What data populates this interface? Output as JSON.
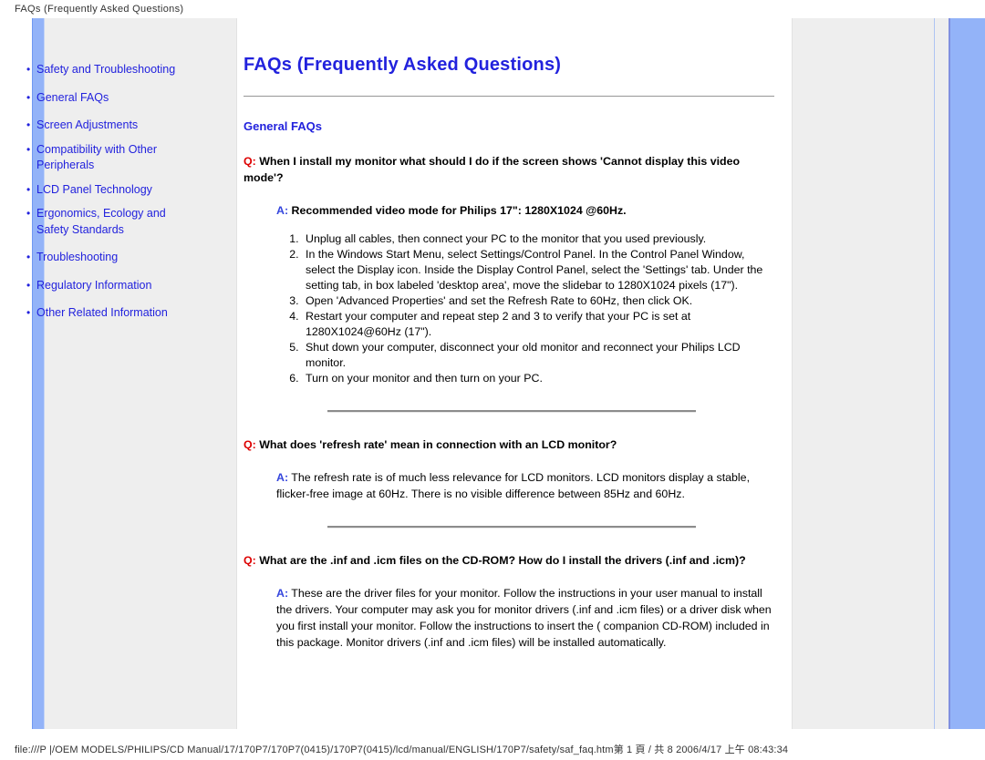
{
  "print": {
    "header": "FAQs (Frequently Asked Questions)",
    "footer": "file:///P |/OEM MODELS/PHILIPS/CD Manual/17/170P7/170P7(0415)/170P7(0415)/lcd/manual/ENGLISH/170P7/safety/saf_faq.htm第 1 頁 / 共 8 2006/4/17 上午 08:43:34"
  },
  "sidebar": {
    "items": [
      {
        "label": "Safety and Troubleshooting"
      },
      {
        "label": "General FAQs"
      },
      {
        "label": "Screen Adjustments"
      },
      {
        "label": "Compatibility with Other Peripherals"
      },
      {
        "label": "LCD Panel Technology"
      },
      {
        "label": "Ergonomics, Ecology and Safety Standards"
      },
      {
        "label": "Troubleshooting"
      },
      {
        "label": "Regulatory Information"
      },
      {
        "label": "Other Related Information"
      }
    ]
  },
  "content": {
    "title": "FAQs (Frequently Asked Questions)",
    "section_title": "General FAQs",
    "q_prefix": "Q:",
    "a_prefix": "A:",
    "faqs": [
      {
        "question": "When I install my monitor what should I do if the screen shows 'Cannot display this video mode'?",
        "answer": "Recommended video mode for Philips 17\": 1280X1024 @60Hz.",
        "answer_bold": true,
        "steps": [
          "Unplug all cables, then connect your PC to the monitor that you used previously.",
          "In the Windows Start Menu, select Settings/Control Panel. In the Control Panel Window, select the Display icon. Inside the Display Control Panel, select the 'Settings' tab. Under the setting tab, in box labeled 'desktop area', move the slidebar to 1280X1024 pixels (17\").",
          "Open 'Advanced Properties' and set the Refresh Rate to 60Hz, then click OK.",
          "Restart your computer and repeat step 2 and 3 to verify that your PC is set at 1280X1024@60Hz (17\").",
          "Shut down your computer, disconnect your old monitor and reconnect your Philips LCD monitor.",
          "Turn on your monitor and then turn on your PC."
        ]
      },
      {
        "question": "What does 'refresh rate' mean in connection with an LCD monitor?",
        "answer": "The refresh rate is of much less relevance for LCD monitors. LCD monitors display a stable, flicker-free image at 60Hz. There is no visible difference between 85Hz and 60Hz.",
        "answer_bold": false,
        "steps": []
      },
      {
        "question": "What are the .inf and .icm files on the CD-ROM? How do I install the drivers (.inf and .icm)?",
        "answer": "These are the driver files for your monitor. Follow the instructions in your user manual to install the drivers. Your computer may ask you for monitor drivers (.inf and .icm files) or a driver disk when you first install your monitor. Follow the instructions to insert the ( companion CD-ROM) included in this package. Monitor drivers (.inf and .icm files) will be installed automatically.",
        "answer_bold": false,
        "steps": []
      }
    ]
  },
  "colors": {
    "link_blue": "#2222dd",
    "q_red": "#dd0000",
    "a_blue": "#3344dd",
    "panel_gray": "#eeeeee",
    "accent_bar": "#93b3f8"
  }
}
